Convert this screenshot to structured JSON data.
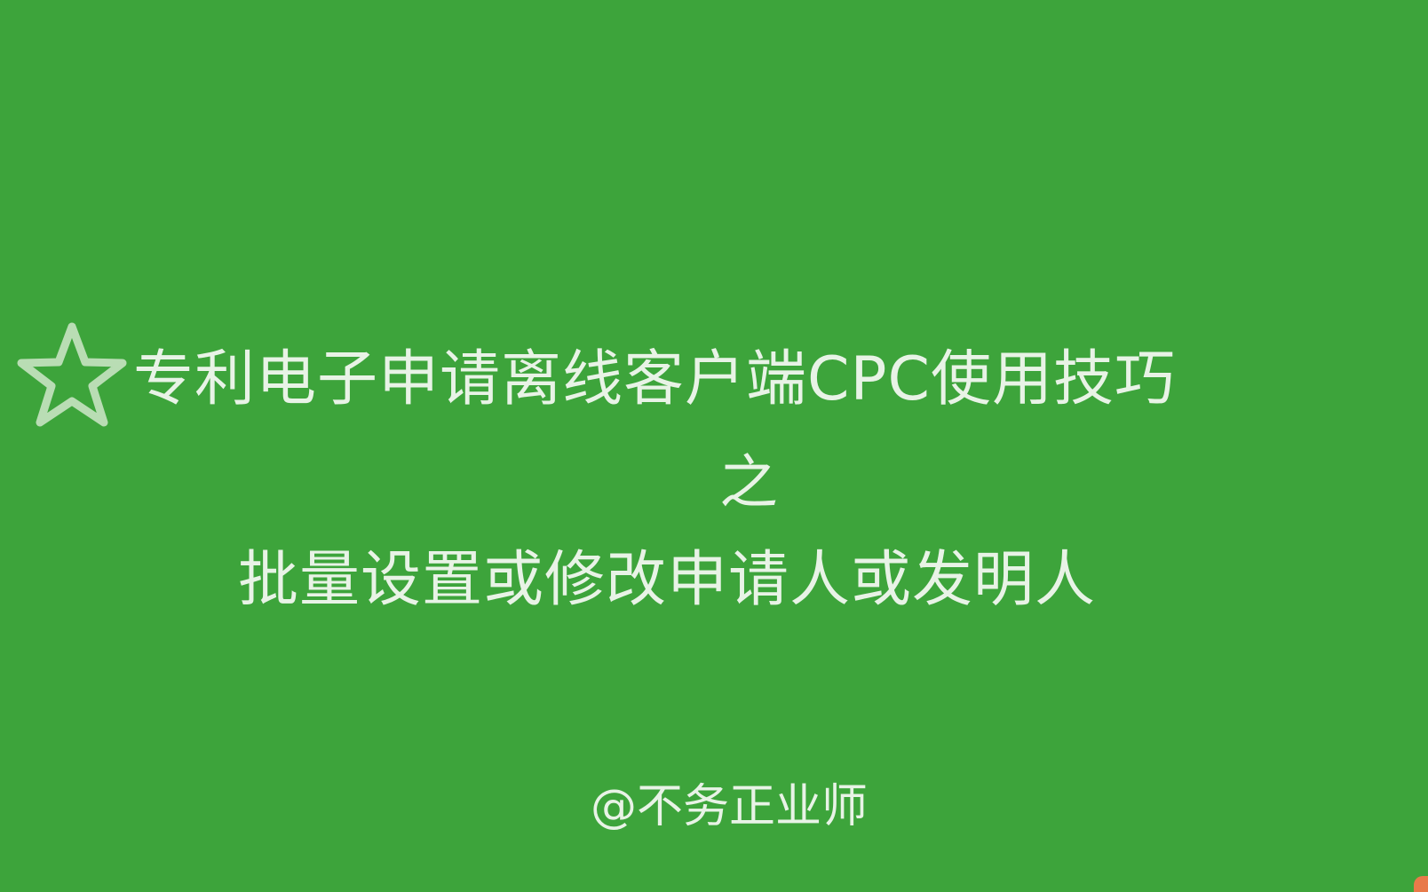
{
  "slide": {
    "title_line1": "专利电子申请离线客户端CPC使用技巧",
    "title_line2": "之",
    "title_line3": "批量设置或修改申请人或发明人",
    "author": "@不务正业师",
    "icon": "star-outline-icon"
  },
  "colors": {
    "background": "#3da43b",
    "text": "#e8f3e6",
    "star": "#b9ddb4",
    "corner_mark": "#e87a4a"
  }
}
